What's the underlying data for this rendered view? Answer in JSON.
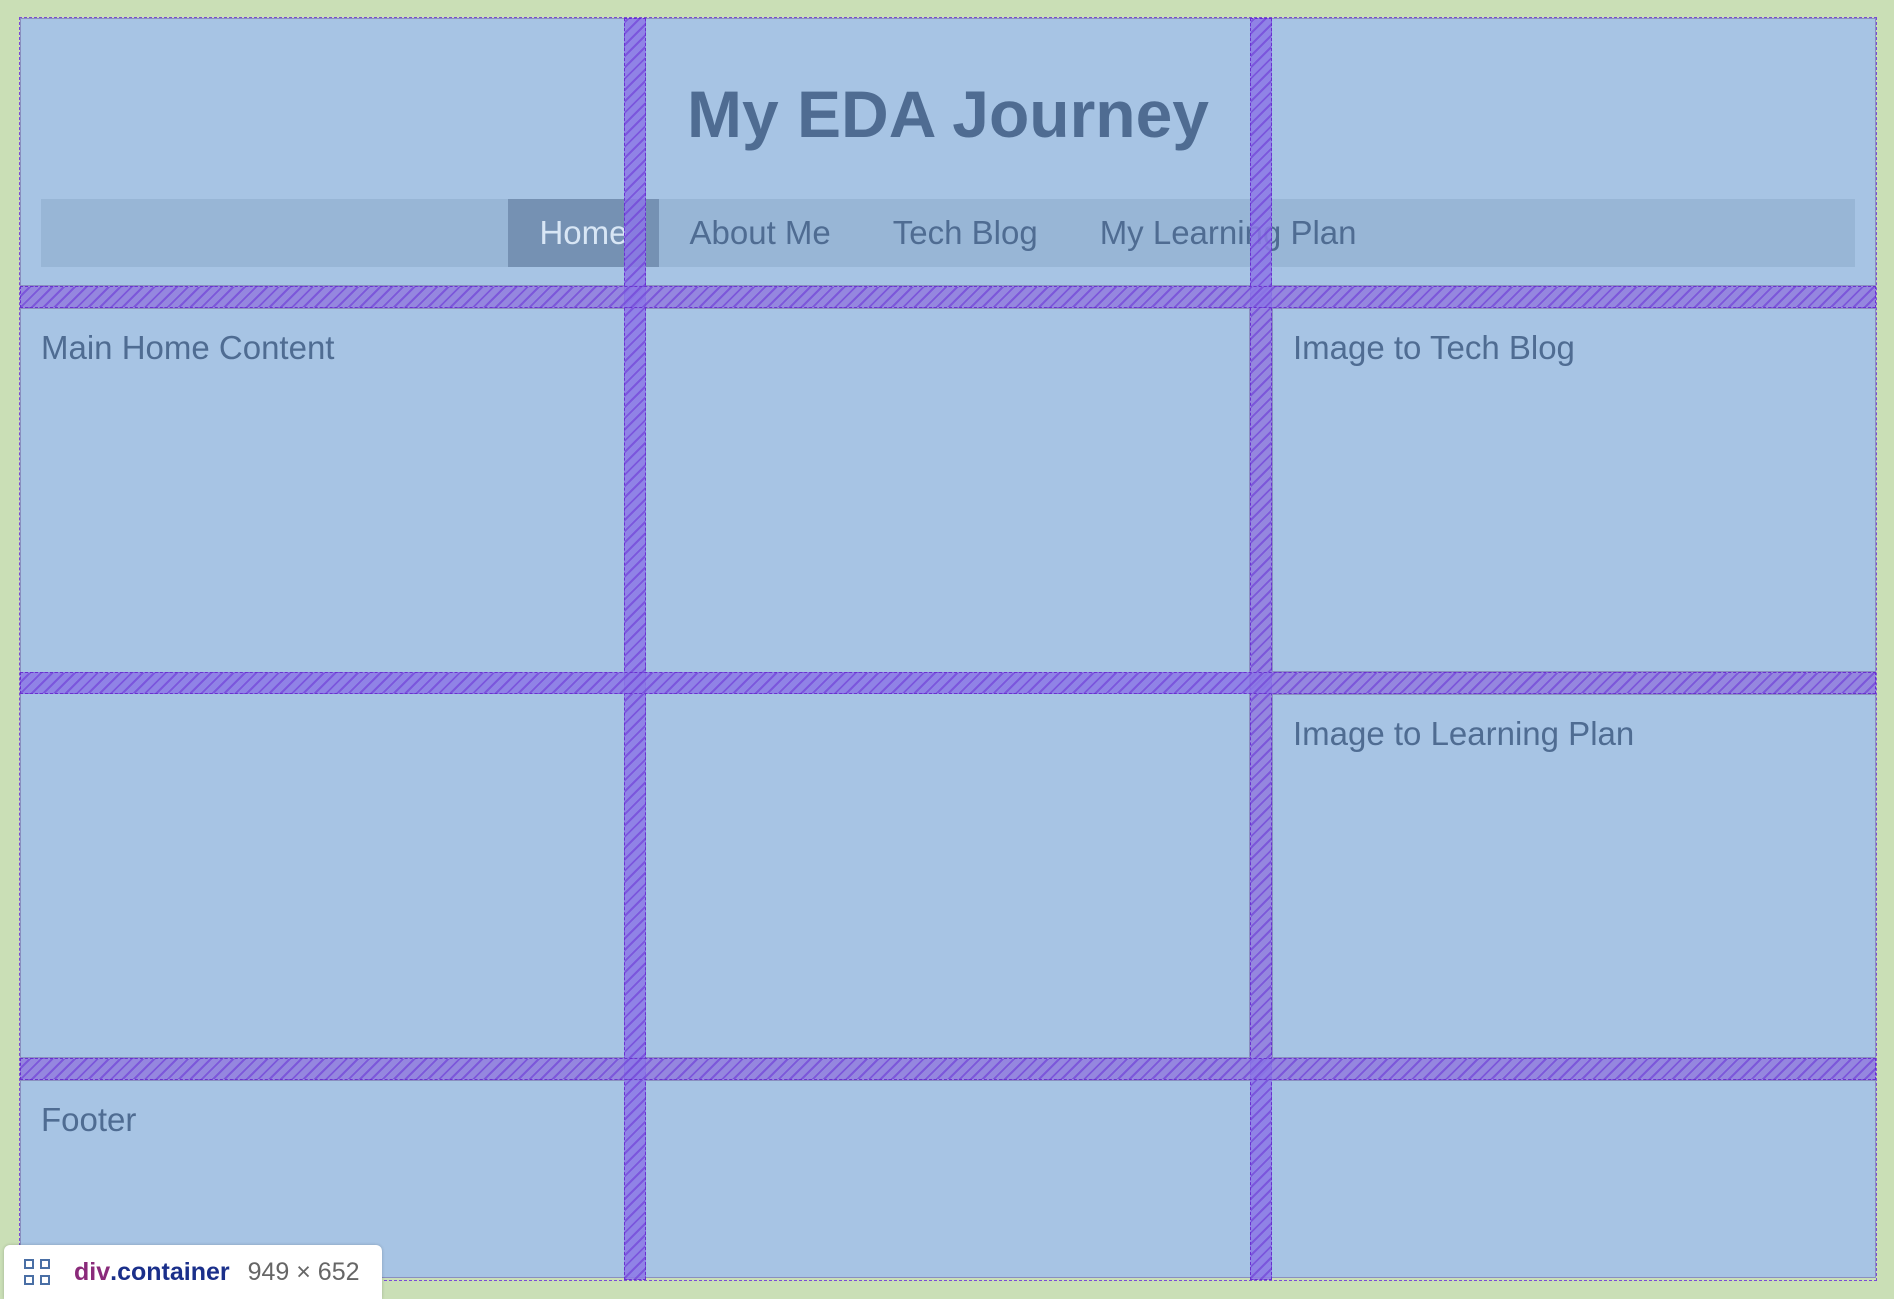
{
  "header": {
    "title": "My EDA Journey"
  },
  "nav": {
    "items": [
      {
        "label": "Home",
        "active": true
      },
      {
        "label": "About Me",
        "active": false
      },
      {
        "label": "Tech Blog",
        "active": false
      },
      {
        "label": "My Learning Plan",
        "active": false
      }
    ]
  },
  "main": {
    "label": "Main Home Content"
  },
  "sidebar": {
    "tech_blog_label": "Image to Tech Blog",
    "learning_plan_label": "Image to Learning Plan"
  },
  "footer": {
    "label": "Footer"
  },
  "devtools": {
    "tag": "div",
    "class_name": ".container",
    "size": "949 × 652"
  },
  "colors": {
    "page_background": "#cadfb6",
    "cell_background": "#a7c4e4",
    "nav_background": "#98b6d6",
    "nav_active_background": "#7591b3",
    "text": "#4f6c92",
    "grid_gap_overlay": "#8c78e6"
  },
  "icons": {
    "badge_icon": "grid-icon"
  }
}
